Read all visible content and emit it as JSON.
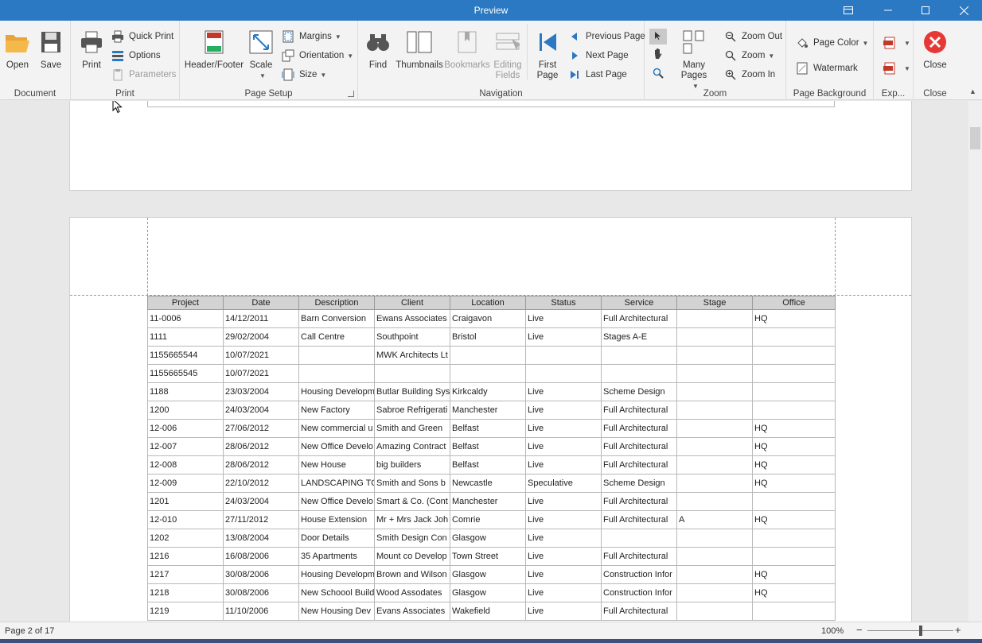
{
  "window": {
    "title": "Preview"
  },
  "ribbon": {
    "groups": {
      "document": "Document",
      "print": "Print",
      "page_setup": "Page Setup",
      "navigation": "Navigation",
      "zoom": "Zoom",
      "page_background": "Page Background",
      "export": "Exp...",
      "close": "Close"
    },
    "open": "Open",
    "save": "Save",
    "print": "Print",
    "quick_print": "Quick Print",
    "options": "Options",
    "parameters": "Parameters",
    "header_footer": "Header/Footer",
    "scale": "Scale",
    "margins": "Margins",
    "orientation": "Orientation",
    "size": "Size",
    "find": "Find",
    "thumbnails": "Thumbnails",
    "bookmarks": "Bookmarks",
    "editing_fields": "Editing Fields",
    "first_page": "First Page",
    "previous_page": "Previous Page",
    "next_page": "Next Page",
    "last_page": "Last Page",
    "many_pages": "Many Pages",
    "zoom_out": "Zoom Out",
    "zoom": "Zoom",
    "zoom_in": "Zoom In",
    "page_color": "Page Color",
    "watermark": "Watermark",
    "close": "Close"
  },
  "table": {
    "columns": [
      "Project",
      "Date",
      "Description",
      "Client",
      "Location",
      "Status",
      "Service",
      "Stage",
      "Office"
    ],
    "rows": [
      [
        "11-0006",
        "14/12/2011",
        "Barn Conversion",
        "Ewans Associates",
        "Craigavon",
        "Live",
        "Full Architectural",
        "",
        "HQ"
      ],
      [
        "1111",
        "29/02/2004",
        "Call Centre",
        "Southpoint",
        "Bristol",
        "Live",
        "Stages A-E",
        "",
        ""
      ],
      [
        "1155665544",
        "10/07/2021",
        "",
        "MWK Architects Lt",
        "",
        "",
        "",
        "",
        ""
      ],
      [
        "1155665545",
        "10/07/2021",
        "",
        "",
        "",
        "",
        "",
        "",
        ""
      ],
      [
        "1188",
        "23/03/2004",
        "Housing Developm",
        "Butlar Building Sys",
        "Kirkcaldy",
        "Live",
        "Scheme Design",
        "",
        ""
      ],
      [
        "1200",
        "24/03/2004",
        "New Factory",
        "Sabroe Refrigerati",
        "Manchester",
        "Live",
        "Full Architectural",
        "",
        ""
      ],
      [
        "12-006",
        "27/06/2012",
        "New commercial u",
        "Smith and Green",
        "Belfast",
        "Live",
        "Full Architectural",
        "",
        "HQ"
      ],
      [
        "12-007",
        "28/06/2012",
        "New Office Develo",
        "Amazing Contract",
        "Belfast",
        "Live",
        "Full Architectural",
        "",
        "HQ"
      ],
      [
        "12-008",
        "28/06/2012",
        "New House",
        "big builders",
        "Belfast",
        "Live",
        "Full Architectural",
        "",
        "HQ"
      ],
      [
        "12-009",
        "22/10/2012",
        "LANDSCAPING TO",
        "Smith and Sons b",
        "Newcastle",
        "Speculative",
        "Scheme Design",
        "",
        "HQ"
      ],
      [
        "1201",
        "24/03/2004",
        "New Office Develo",
        "Smart & Co. (Cont",
        "Manchester",
        "Live",
        "Full Architectural",
        "",
        ""
      ],
      [
        "12-010",
        "27/11/2012",
        "House Extension",
        "Mr + Mrs Jack Joh",
        "Comrie",
        "Live",
        "Full Architectural",
        "A",
        "HQ"
      ],
      [
        "1202",
        "13/08/2004",
        "Door Details",
        " Smith Design Con",
        "Glasgow",
        "Live",
        "",
        "",
        ""
      ],
      [
        "1216",
        "16/08/2006",
        "35 Apartments",
        "Mount co Develop",
        "Town Street",
        "Live",
        "Full Architectural",
        "",
        ""
      ],
      [
        "1217",
        "30/08/2006",
        "Housing Developm",
        "Brown and Wilson",
        "Glasgow",
        "Live",
        "Construction Infor",
        "",
        "HQ"
      ],
      [
        "1218",
        "30/08/2006",
        "New Schoool Build",
        "Wood Assodates",
        "Glasgow",
        "Live",
        "Construction Infor",
        "",
        "HQ"
      ],
      [
        "1219",
        "11/10/2006",
        "New Housing Dev",
        "Evans Associates",
        "Wakefield",
        "Live",
        "Full Architectural",
        "",
        ""
      ]
    ]
  },
  "status": {
    "page_info": "Page 2 of 17",
    "zoom_level": "100%",
    "zoom_fraction": 0.62
  }
}
